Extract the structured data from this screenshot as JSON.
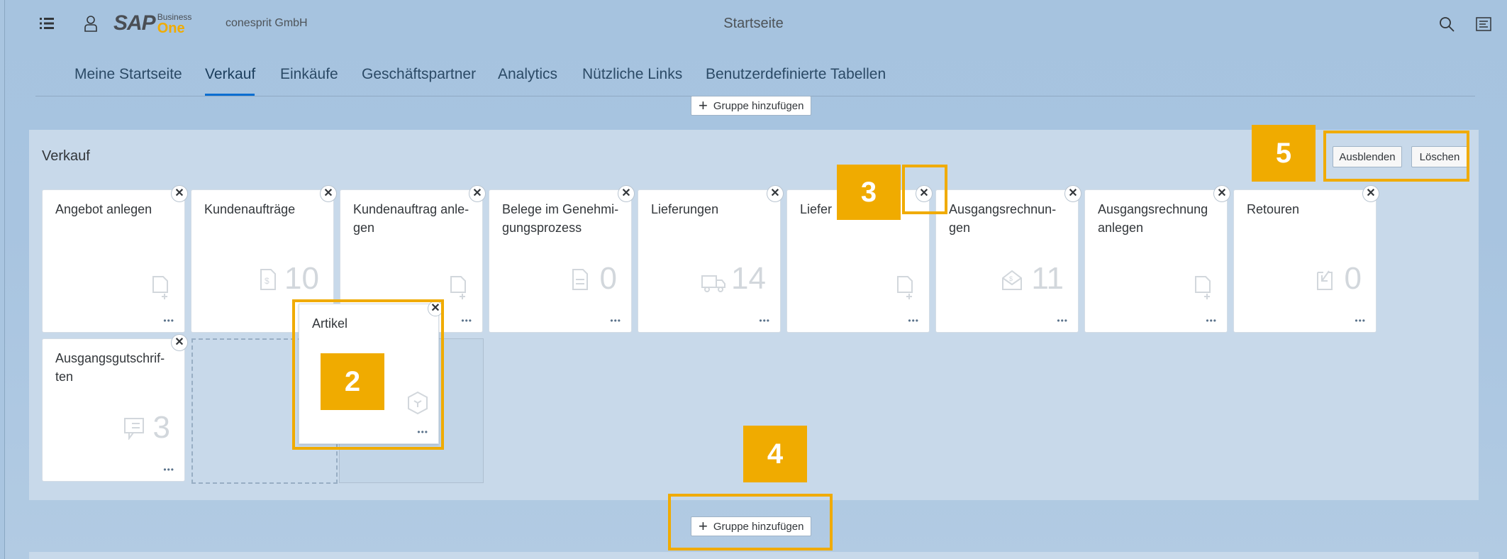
{
  "shell": {
    "logo_sap": "SAP",
    "logo_business": "Business",
    "logo_one": "One",
    "company": "conesprit GmbH",
    "title": "Startseite"
  },
  "tabs": [
    {
      "label": "Meine Startseite"
    },
    {
      "label": "Verkauf",
      "active": true
    },
    {
      "label": "Einkäufe"
    },
    {
      "label": "Geschäftspartner"
    },
    {
      "label": "Analytics"
    },
    {
      "label": "Nützliche Links"
    },
    {
      "label": "Benutzerdefinierte Tabellen"
    }
  ],
  "add_group_label": "Gruppe hinzufügen",
  "group": {
    "title": "Verkauf",
    "hide_label": "Ausblenden",
    "delete_label": "Löschen"
  },
  "tiles": [
    {
      "title": "Angebot anlegen",
      "number": "",
      "icon": "document-add-icon"
    },
    {
      "title": "Kundenaufträge",
      "number": "10",
      "icon": "sales-order-icon"
    },
    {
      "title": "Kundenauftrag anle-gen",
      "number": "",
      "icon": "document-add-icon"
    },
    {
      "title": "Belege im Genehmi-gungsprozess",
      "number": "0",
      "icon": "document-icon"
    },
    {
      "title": "Lieferungen",
      "number": "14",
      "icon": "truck-icon"
    },
    {
      "title": "Liefer",
      "number": "",
      "icon": "document-add-icon"
    },
    {
      "title": "Ausgangsrechnun-gen",
      "number": "11",
      "icon": "invoice-envelope-icon"
    },
    {
      "title": "Ausgangsrechnung anlegen",
      "number": "",
      "icon": "document-add-icon"
    },
    {
      "title": "Retouren",
      "number": "0",
      "icon": "return-icon"
    },
    {
      "title": "Ausgangsgutschrif-ten",
      "number": "3",
      "icon": "credit-memo-icon"
    }
  ],
  "drag_tile": {
    "title": "Artikel",
    "icon": "item-cube-icon"
  },
  "dots": "•••",
  "close_glyph": "✕",
  "callouts": [
    "2",
    "3",
    "4",
    "5"
  ],
  "colors": {
    "accent": "#f0ab00",
    "link": "#0a6ed1",
    "shell_bg": "#a9c5e0",
    "group_bg": "#c8d9ea"
  }
}
